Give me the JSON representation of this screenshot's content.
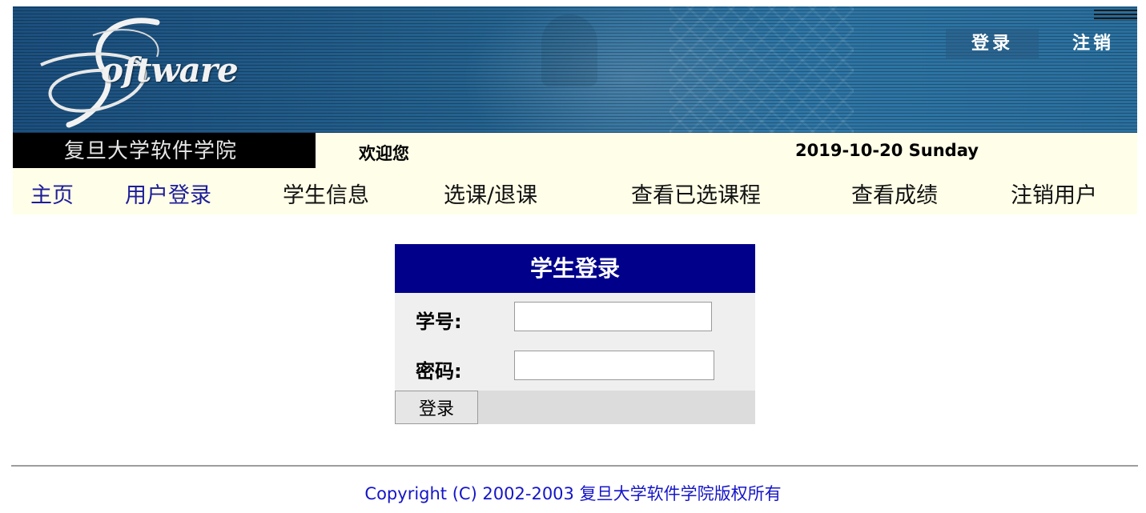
{
  "banner": {
    "logo_text": "oftware",
    "login_button": "登录",
    "logout_button": "注销"
  },
  "infobar": {
    "school_name": "复旦大学软件学院",
    "welcome": "欢迎您",
    "date": "2019-10-20 Sunday"
  },
  "nav": {
    "items": [
      {
        "label": "主页"
      },
      {
        "label": "用户登录"
      },
      {
        "label": "学生信息"
      },
      {
        "label": "选课/退课"
      },
      {
        "label": "查看已选课程"
      },
      {
        "label": "查看成绩"
      },
      {
        "label": "注销用户"
      }
    ]
  },
  "login": {
    "title": "学生登录",
    "student_id_label": "学号:",
    "student_id_value": "",
    "password_label": "密码:",
    "password_value": "",
    "submit_label": "登录"
  },
  "footer": {
    "copyright": "Copyright (C) 2002-2003 复旦大学软件学院版权所有"
  },
  "colors": {
    "banner_blue": "#2a6f9e",
    "nav_link": "#1d1d9a",
    "header_navy": "#00008b",
    "infobar_bg": "#fffee8",
    "copyright": "#1515c8"
  }
}
